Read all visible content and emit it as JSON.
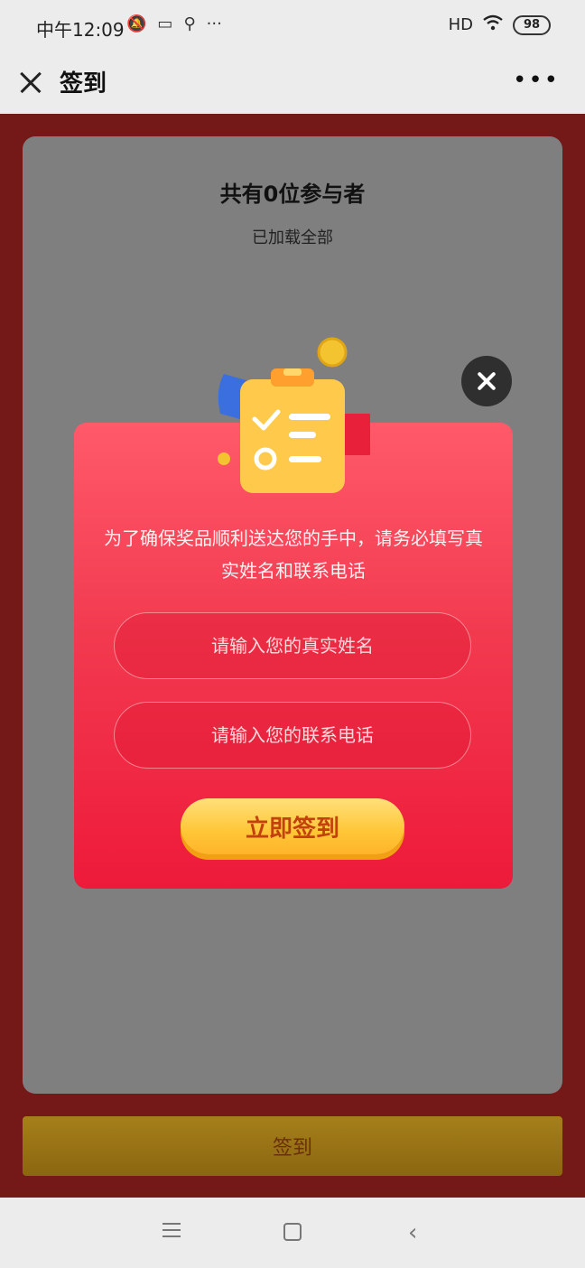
{
  "status_bar": {
    "time": "中午12:09",
    "signal": "HD",
    "battery": "98"
  },
  "titlebar": {
    "title": "签到"
  },
  "main": {
    "participants": "共有0位参与者",
    "loaded": "已加载全部",
    "bottom_button": "签到"
  },
  "popup": {
    "message": "为了确保奖品顺利送达您的手中，请务必填写真实姓名和联系电话",
    "name_placeholder": "请输入您的真实姓名",
    "phone_placeholder": "请输入您的联系电话",
    "submit_label": "立即签到"
  },
  "colors": {
    "popup_top": "#ff5a6a",
    "popup_bottom": "#ee1a3a",
    "button_gold": "#ffc636",
    "button_text": "#c2410c",
    "overlay_card": "#7f7f7f"
  }
}
